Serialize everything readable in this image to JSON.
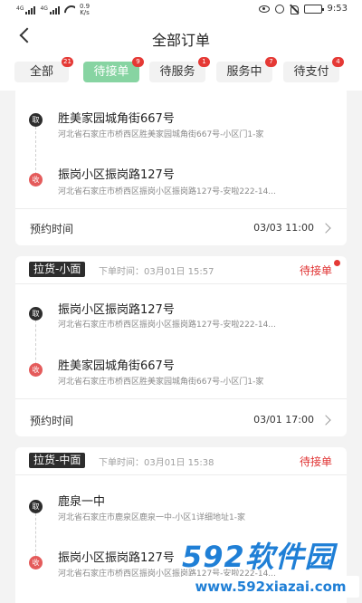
{
  "status_bar": {
    "sig1_tag": "4G",
    "sig2_tag": "4G",
    "speed_value": "0.9",
    "speed_unit": "K/s",
    "time": "9:53",
    "battery_level": 0.85
  },
  "header": {
    "title": "全部订单"
  },
  "tabs": [
    {
      "label": "全部",
      "badge": "21",
      "active": false
    },
    {
      "label": "待接单",
      "badge": "9",
      "active": true
    },
    {
      "label": "待服务",
      "badge": "1",
      "active": false
    },
    {
      "label": "服务中",
      "badge": "7",
      "active": false
    },
    {
      "label": "待支付",
      "badge": "4",
      "active": false
    }
  ],
  "orders": [
    {
      "pickup": {
        "marker": "取",
        "name": "胜美家园城角街667号",
        "address": "河北省石家庄市桥西区胜美家园城角街667号-小区门1-家"
      },
      "dropoff": {
        "marker": "收",
        "name": "振岗小区振岗路127号",
        "address": "河北省石家庄市桥西区振岗小区振岗路127号-安啦222-14..."
      },
      "appointment_label": "预约时间",
      "appointment_time": "03/03 11:00"
    },
    {
      "type": "拉货-小面",
      "order_time": "下单时间：03月01日 15:57",
      "status": "待接单",
      "pickup": {
        "marker": "取",
        "name": "振岗小区振岗路127号",
        "address": "河北省石家庄市桥西区振岗小区振岗路127号-安啦222-14..."
      },
      "dropoff": {
        "marker": "收",
        "name": "胜美家园城角街667号",
        "address": "河北省石家庄市桥西区胜美家园城角街667号-小区门1-家"
      },
      "appointment_label": "预约时间",
      "appointment_time": "03/01 17:00"
    },
    {
      "type": "拉货-中面",
      "order_time": "下单时间：03月01日 15:38",
      "status": "待接单",
      "pickup": {
        "marker": "取",
        "name": "鹿泉一中",
        "address": "河北省石家庄市鹿泉区鹿泉一中-小区1详细地址1-家"
      },
      "dropoff": {
        "marker": "收",
        "name": "振岗小区振岗路127号",
        "address": "河北省石家庄市桥西区振岗小区振岗路127号-安啦222-14..."
      }
    }
  ],
  "watermark": {
    "logo": "592软件园",
    "url": "www.592xiazai.com"
  }
}
